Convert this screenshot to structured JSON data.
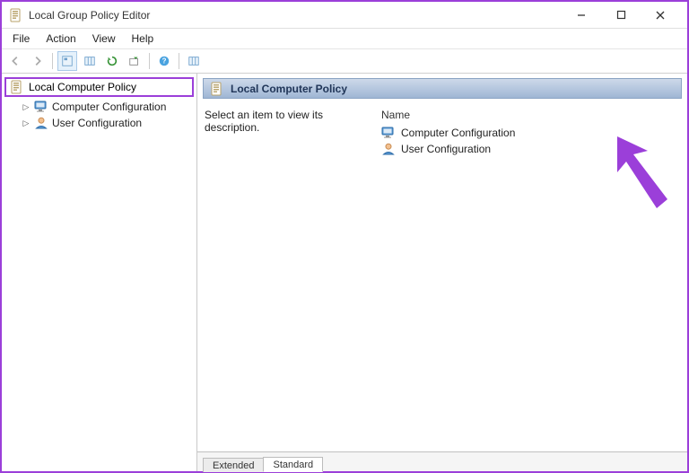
{
  "window": {
    "title": "Local Group Policy Editor"
  },
  "menubar": {
    "file": "File",
    "action": "Action",
    "view": "View",
    "help": "Help"
  },
  "tree": {
    "root": "Local Computer Policy",
    "children": [
      {
        "label": "Computer Configuration",
        "icon": "computer"
      },
      {
        "label": "User Configuration",
        "icon": "user"
      }
    ]
  },
  "content": {
    "header": "Local Computer Policy",
    "description_prompt": "Select an item to view its description.",
    "name_header": "Name",
    "items": [
      {
        "label": "Computer Configuration",
        "icon": "computer"
      },
      {
        "label": "User Configuration",
        "icon": "user"
      }
    ]
  },
  "tabs": {
    "extended": "Extended",
    "standard": "Standard"
  }
}
